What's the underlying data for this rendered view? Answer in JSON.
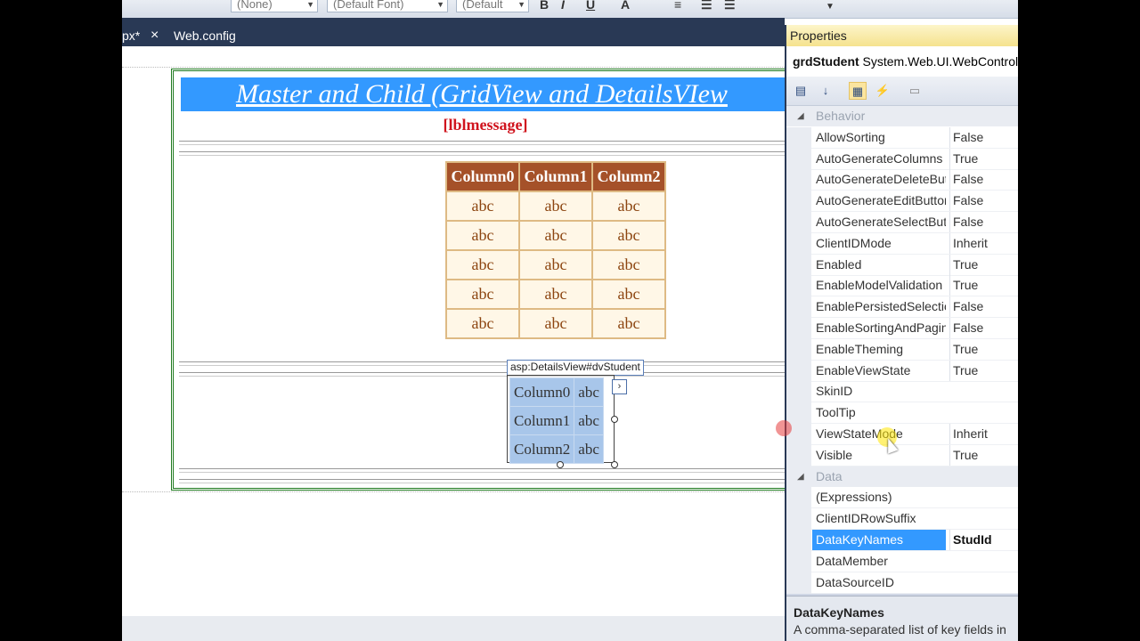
{
  "toolbar": {
    "combo_none": "(None)",
    "combo_font": "(Default Font)",
    "combo_size": "(Default",
    "bold": "B",
    "italic": "I",
    "underline": "U"
  },
  "tabs": [
    {
      "label": "px*",
      "close": "×"
    },
    {
      "label": "Web.config"
    }
  ],
  "designer": {
    "banner_title": "Master and Child (GridView and DetailsVIew",
    "label_message": "[lblmessage]",
    "grid": {
      "headers": [
        "Column0",
        "Column1",
        "Column2"
      ],
      "rows": [
        [
          "abc",
          "abc",
          "abc"
        ],
        [
          "abc",
          "abc",
          "abc"
        ],
        [
          "abc",
          "abc",
          "abc"
        ],
        [
          "abc",
          "abc",
          "abc"
        ],
        [
          "abc",
          "abc",
          "abc"
        ]
      ]
    },
    "details_view": {
      "tag_label": "asp:DetailsView#dvStudent",
      "smart_tag": "›",
      "rows": [
        {
          "field": "Column0",
          "value": "abc"
        },
        {
          "field": "Column1",
          "value": "abc"
        },
        {
          "field": "Column2",
          "value": "abc"
        }
      ]
    }
  },
  "properties": {
    "title": "Properties",
    "object_name": "grdStudent",
    "object_type": "System.Web.UI.WebControls.GridView",
    "categories": [
      {
        "name": "Behavior",
        "items": [
          {
            "name": "AllowSorting",
            "value": "False"
          },
          {
            "name": "AutoGenerateColumns",
            "value": "True"
          },
          {
            "name": "AutoGenerateDeleteButton",
            "value": "False"
          },
          {
            "name": "AutoGenerateEditButton",
            "value": "False"
          },
          {
            "name": "AutoGenerateSelectButton",
            "value": "False"
          },
          {
            "name": "ClientIDMode",
            "value": "Inherit"
          },
          {
            "name": "Enabled",
            "value": "True"
          },
          {
            "name": "EnableModelValidation",
            "value": "True"
          },
          {
            "name": "EnablePersistedSelection",
            "value": "False"
          },
          {
            "name": "EnableSortingAndPagingCallbacks",
            "value": "False"
          },
          {
            "name": "EnableTheming",
            "value": "True"
          },
          {
            "name": "EnableViewState",
            "value": "True"
          },
          {
            "name": "SkinID",
            "value": ""
          },
          {
            "name": "ToolTip",
            "value": ""
          },
          {
            "name": "ViewStateMode",
            "value": "Inherit"
          },
          {
            "name": "Visible",
            "value": "True"
          }
        ]
      },
      {
        "name": "Data",
        "items": [
          {
            "name": "(Expressions)",
            "value": ""
          },
          {
            "name": "ClientIDRowSuffix",
            "value": ""
          },
          {
            "name": "DataKeyNames",
            "value": "StudId",
            "selected": true
          },
          {
            "name": "DataMember",
            "value": ""
          },
          {
            "name": "DataSourceID",
            "value": ""
          }
        ]
      }
    ],
    "description_title": "DataKeyNames",
    "description_text": "A comma-separated list of key fields in"
  }
}
